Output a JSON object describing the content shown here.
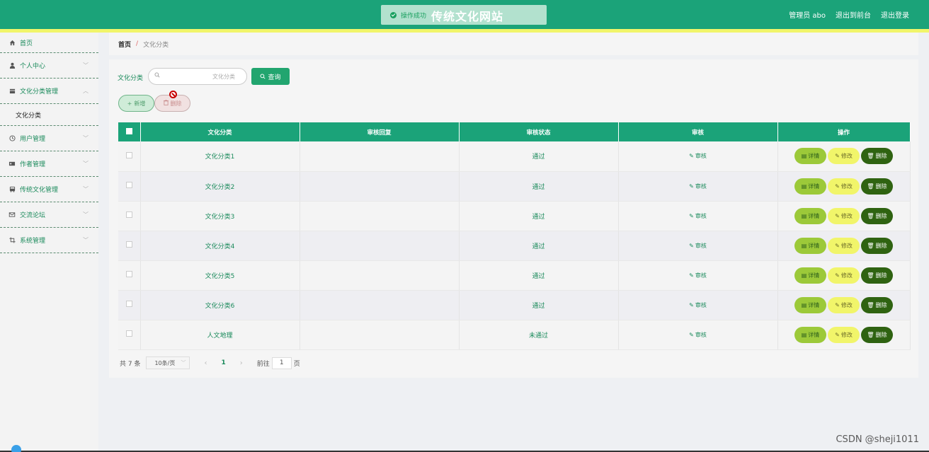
{
  "header": {
    "site_title": "传统文化网站",
    "toast": "操作成功",
    "admin_label": "管理员 abo",
    "back_front": "退出到前台",
    "logout": "退出登录"
  },
  "sidebar": {
    "items": [
      {
        "label": "首页",
        "icon": "home-icon"
      },
      {
        "label": "个人中心",
        "icon": "user-icon"
      },
      {
        "label": "文化分类管理",
        "icon": "category-icon"
      },
      {
        "label": "文化分类",
        "icon": ""
      },
      {
        "label": "用户管理",
        "icon": "clock-icon"
      },
      {
        "label": "作者管理",
        "icon": "id-card-icon"
      },
      {
        "label": "传统文化管理",
        "icon": "bus-icon"
      },
      {
        "label": "交流论坛",
        "icon": "mail-icon"
      },
      {
        "label": "系统管理",
        "icon": "crop-icon"
      }
    ]
  },
  "breadcrumb": {
    "home": "首页",
    "sep": "/",
    "current": "文化分类"
  },
  "search": {
    "label": "文化分类",
    "placeholder": "文化分类",
    "button": "查询"
  },
  "actions": {
    "add": "新增",
    "delete": "删除"
  },
  "table": {
    "headers": [
      "文化分类",
      "审核回复",
      "审核状态",
      "审核",
      "操作"
    ],
    "rows": [
      {
        "category": "文化分类1",
        "reply": "",
        "status": "通过",
        "audit": "审核"
      },
      {
        "category": "文化分类2",
        "reply": "",
        "status": "通过",
        "audit": "审核"
      },
      {
        "category": "文化分类3",
        "reply": "",
        "status": "通过",
        "audit": "审核"
      },
      {
        "category": "文化分类4",
        "reply": "",
        "status": "通过",
        "audit": "审核"
      },
      {
        "category": "文化分类5",
        "reply": "",
        "status": "通过",
        "audit": "审核"
      },
      {
        "category": "文化分类6",
        "reply": "",
        "status": "通过",
        "audit": "审核"
      },
      {
        "category": "人文地理",
        "reply": "",
        "status": "未通过",
        "audit": "审核"
      }
    ],
    "op_detail": "详情",
    "op_edit": "修改",
    "op_delete": "删除"
  },
  "pager": {
    "total": "共 7 条",
    "page_size": "10条/页",
    "current": "1",
    "goto_label": "前往",
    "goto_value": "1",
    "goto_suffix": "页"
  },
  "watermark": "CSDN @sheji1011",
  "colors": {
    "primary": "#1ba379",
    "accent_yellow": "#f1f56a",
    "detail_btn": "#9cc939",
    "delete_btn": "#2f6311"
  }
}
